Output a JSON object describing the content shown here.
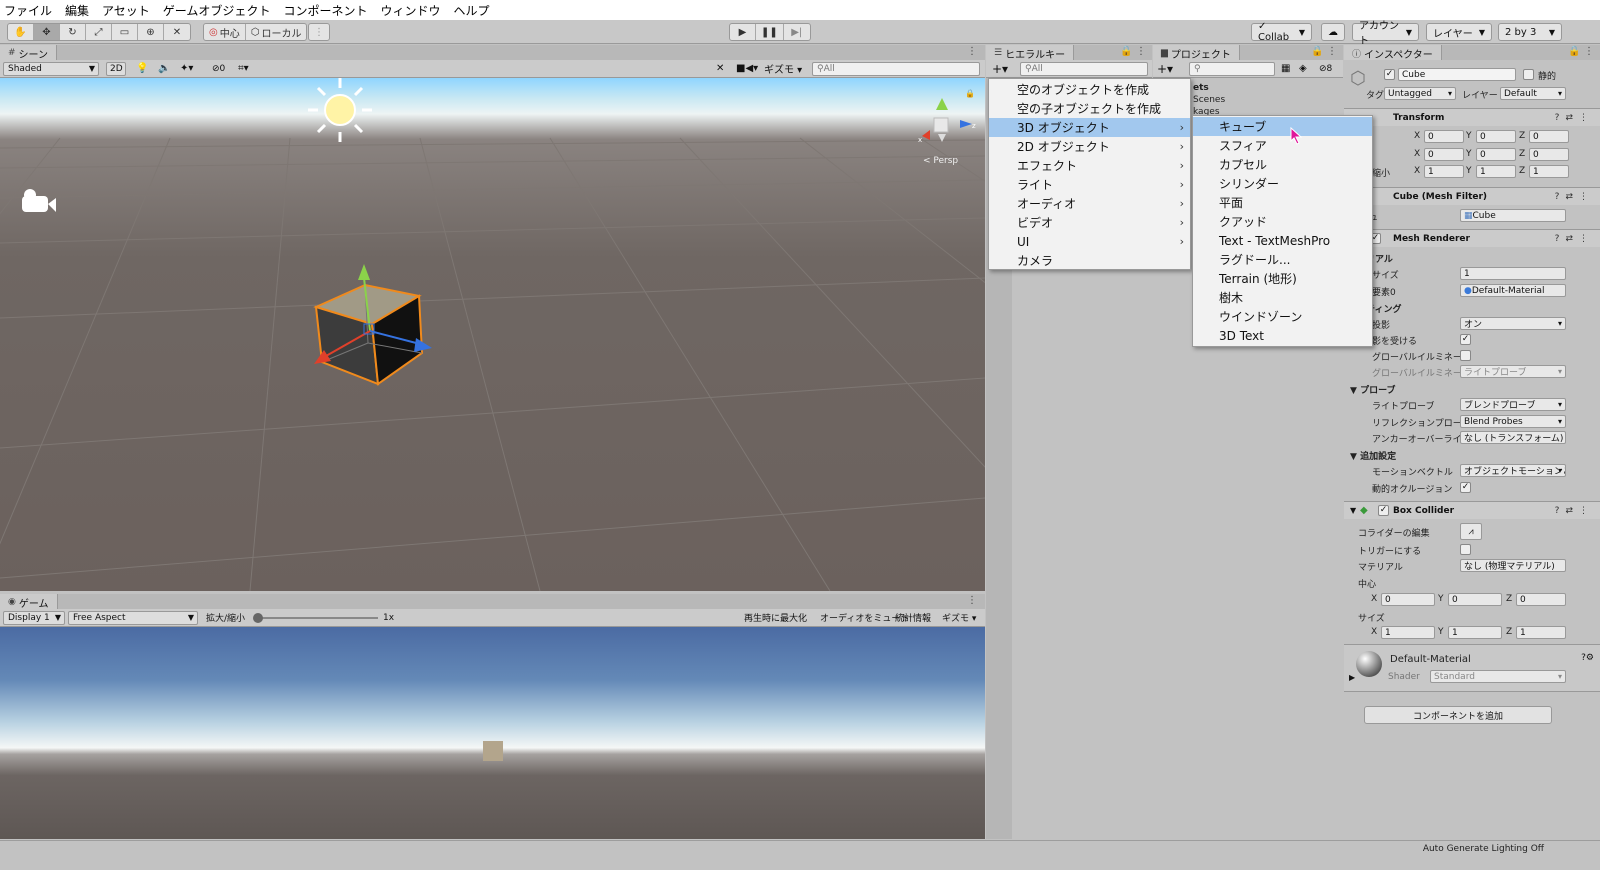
{
  "menubar": [
    "ファイル",
    "編集",
    "アセット",
    "ゲームオブジェクト",
    "コンポーネント",
    "ウィンドウ",
    "ヘルプ"
  ],
  "toolbar": {
    "pivot_center": "中心",
    "pivot_local": "ローカル",
    "collab": "Collab",
    "account": "アカウント",
    "layers": "レイヤー",
    "layout": "2 by 3"
  },
  "scene": {
    "tab": "シーン",
    "shading": "Shaded",
    "mode_2d": "2D",
    "hidden_count": "0",
    "gizmos": "ギズモ",
    "search_placeholder": "All",
    "persp_label": "< Persp",
    "axis_x": "x",
    "axis_z": "z"
  },
  "game": {
    "tab": "ゲーム",
    "display": "Display 1",
    "aspect": "Free Aspect",
    "scale_label": "拡大/縮小",
    "scale_value": "1x",
    "scale_slider": 0,
    "maximize": "再生時に最大化",
    "mute": "オーディオをミュート",
    "stats": "統計情報",
    "gizmos": "ギズモ"
  },
  "hierarchy": {
    "tab": "ヒエラルキー",
    "search_placeholder": "All"
  },
  "project": {
    "tab": "プロジェクト",
    "count": "8",
    "items": [
      "ets",
      "Scenes",
      "kages"
    ]
  },
  "create_menu": {
    "items": [
      {
        "label": "空のオブジェクトを作成",
        "submenu": false
      },
      {
        "label": "空の子オブジェクトを作成",
        "submenu": false
      },
      {
        "label": "3D オブジェクト",
        "submenu": true,
        "selected": true
      },
      {
        "label": "2D オブジェクト",
        "submenu": true
      },
      {
        "label": "エフェクト",
        "submenu": true
      },
      {
        "label": "ライト",
        "submenu": true
      },
      {
        "label": "オーディオ",
        "submenu": true
      },
      {
        "label": "ビデオ",
        "submenu": true
      },
      {
        "label": "UI",
        "submenu": true
      },
      {
        "label": "カメラ",
        "submenu": false
      }
    ]
  },
  "submenu_3d": {
    "items": [
      "キューブ",
      "スフィア",
      "カプセル",
      "シリンダー",
      "平面",
      "クアッド",
      "Text - TextMeshPro",
      "ラグドール...",
      "Terrain (地形)",
      "樹木",
      "ウインドゾーン",
      "3D Text"
    ],
    "selected_index": 0
  },
  "inspector": {
    "tab": "インスペクター",
    "object_name": "Cube",
    "static_label": "静的",
    "tag_label": "タグ",
    "tag_value": "Untagged",
    "layer_label": "レイヤー",
    "layer_value": "Default",
    "transform": {
      "title": "Transform",
      "rows": [
        {
          "label": "置",
          "x": "0",
          "y": "0",
          "z": "0"
        },
        {
          "label": "転",
          "x": "0",
          "y": "0",
          "z": "0"
        },
        {
          "label": "大/縮小",
          "x": "1",
          "y": "1",
          "z": "1"
        }
      ]
    },
    "mesh_filter": {
      "title": "Cube (Mesh Filter)",
      "label": "シュ",
      "value": "Cube"
    },
    "mesh_renderer": {
      "title": "Mesh Renderer",
      "materials_header": "リアル",
      "size_label": "サイズ",
      "size_value": "1",
      "element_label": "要素0",
      "element_value": "Default-Material",
      "lighting_header": "ティング",
      "cast_label": "投影",
      "cast_value": "オン",
      "receive_label": "影を受ける",
      "gi_label": "グローバルイルミネーシ",
      "gi2_label": "グローバルイルミネーシ",
      "gi2_value": "ライトプローブ",
      "probes_header": "プローブ",
      "light_probe_label": "ライトプローブ",
      "light_probe_value": "ブレンドプローブ",
      "reflection_label": "リフレクションプローブ",
      "reflection_value": "Blend Probes",
      "anchor_label": "アンカーオーバーライド",
      "anchor_value": "なし (トランスフォーム)",
      "additional_header": "追加設定",
      "motion_label": "モーションベクトル",
      "motion_value": "オブジェクトモーションごと",
      "dynamic_occ_label": "動的オクルージョン"
    },
    "box_collider": {
      "title": "Box Collider",
      "edit_label": "コライダーの編集",
      "trigger_label": "トリガーにする",
      "material_label": "マテリアル",
      "material_value": "なし (物理マテリアル)",
      "center_label": "中心",
      "center": {
        "x": "0",
        "y": "0",
        "z": "0"
      },
      "size_label": "サイズ",
      "size": {
        "x": "1",
        "y": "1",
        "z": "1"
      }
    },
    "material": {
      "name": "Default-Material",
      "shader_label": "Shader",
      "shader_value": "Standard"
    },
    "add_component": "コンポーネントを追加"
  },
  "statusbar": {
    "text": "Auto Generate Lighting Off"
  },
  "colors": {
    "selection": "#a2c8ee",
    "cube_outline": "#f08a1c",
    "panel": "#c2c2c2"
  }
}
